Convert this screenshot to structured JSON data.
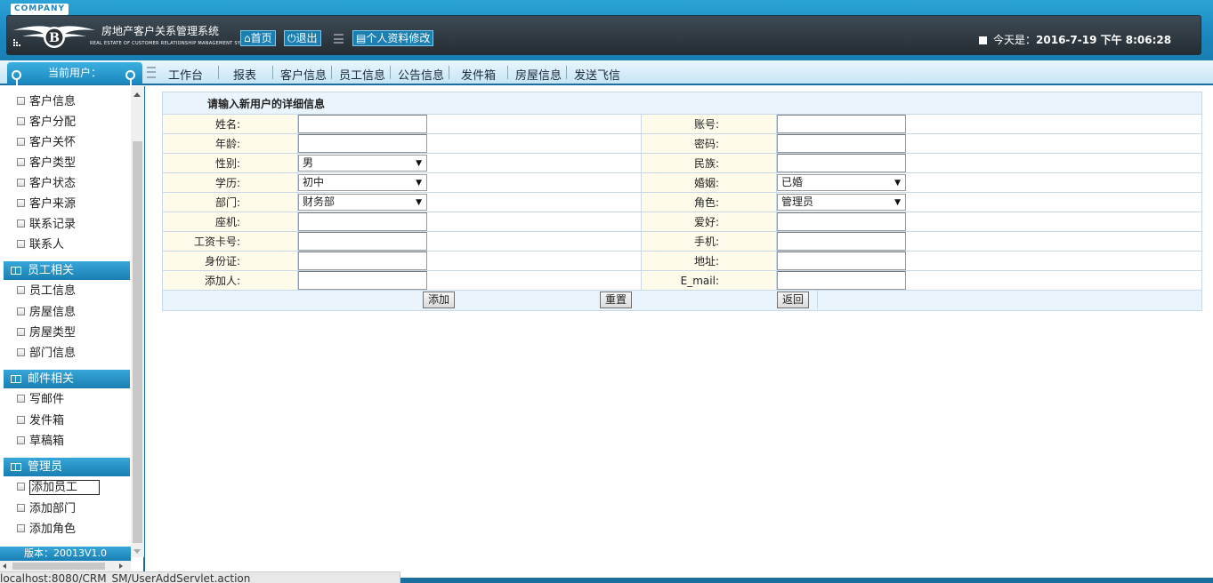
{
  "header": {
    "company": "COMPANY",
    "system_title": "房地产客户关系管理系统",
    "system_subtitle": "REAL ESTATE OF CUSTOMER RELATIONSHIP MANAGEMENT SYSTEM",
    "home_label": "首页",
    "logout_label": "退出",
    "profile_label": "个人资料修改",
    "date_prefix": "今天是：",
    "date_value": "2016-7-19 下午 8:06:28"
  },
  "nav": {
    "current_user_label": "当前用户：",
    "items": [
      "工作台",
      "报表",
      "客户信息",
      "员工信息",
      "公告信息",
      "发件箱",
      "房屋信息",
      "发送飞信"
    ]
  },
  "sidebar": {
    "links_top": [
      "客户信息",
      "客户分配",
      "客户关怀",
      "客户类型",
      "客户状态",
      "客户来源",
      "联系记录",
      "联系人"
    ],
    "section_staff": "员工相关",
    "links_staff": [
      "员工信息",
      "房屋信息",
      "房屋类型",
      "部门信息"
    ],
    "section_mail": "邮件相关",
    "links_mail": [
      "写邮件",
      "发件箱",
      "草稿箱"
    ],
    "section_admin": "管理员",
    "links_admin": [
      "添加员工",
      "添加部门",
      "添加角色"
    ],
    "version": "版本：20013V1.0"
  },
  "form": {
    "heading": "请输入新用户的详细信息",
    "rows": [
      {
        "left_label": "姓名:",
        "right_label": "账号:"
      },
      {
        "left_label": "年龄:",
        "right_label": "密码:"
      },
      {
        "left_label": "性别:",
        "left_select": "男",
        "right_label": "民族:"
      },
      {
        "left_label": "学历:",
        "left_select": "初中",
        "right_label": "婚姻:",
        "right_select": "已婚"
      },
      {
        "left_label": "部门:",
        "left_select": "财务部",
        "right_label": "角色:",
        "right_select": "管理员"
      },
      {
        "left_label": "座机:",
        "right_label": "爱好:"
      },
      {
        "left_label": "工资卡号:",
        "right_label": "手机:"
      },
      {
        "left_label": "身份证:",
        "right_label": "地址:"
      },
      {
        "left_label": "添加人:",
        "right_label": "E_mail:"
      }
    ],
    "add_label": "添加",
    "reset_label": "重置",
    "back_label": "返回"
  },
  "status_bar": "localhost:8080/CRM_SM/UserAddServlet.action"
}
